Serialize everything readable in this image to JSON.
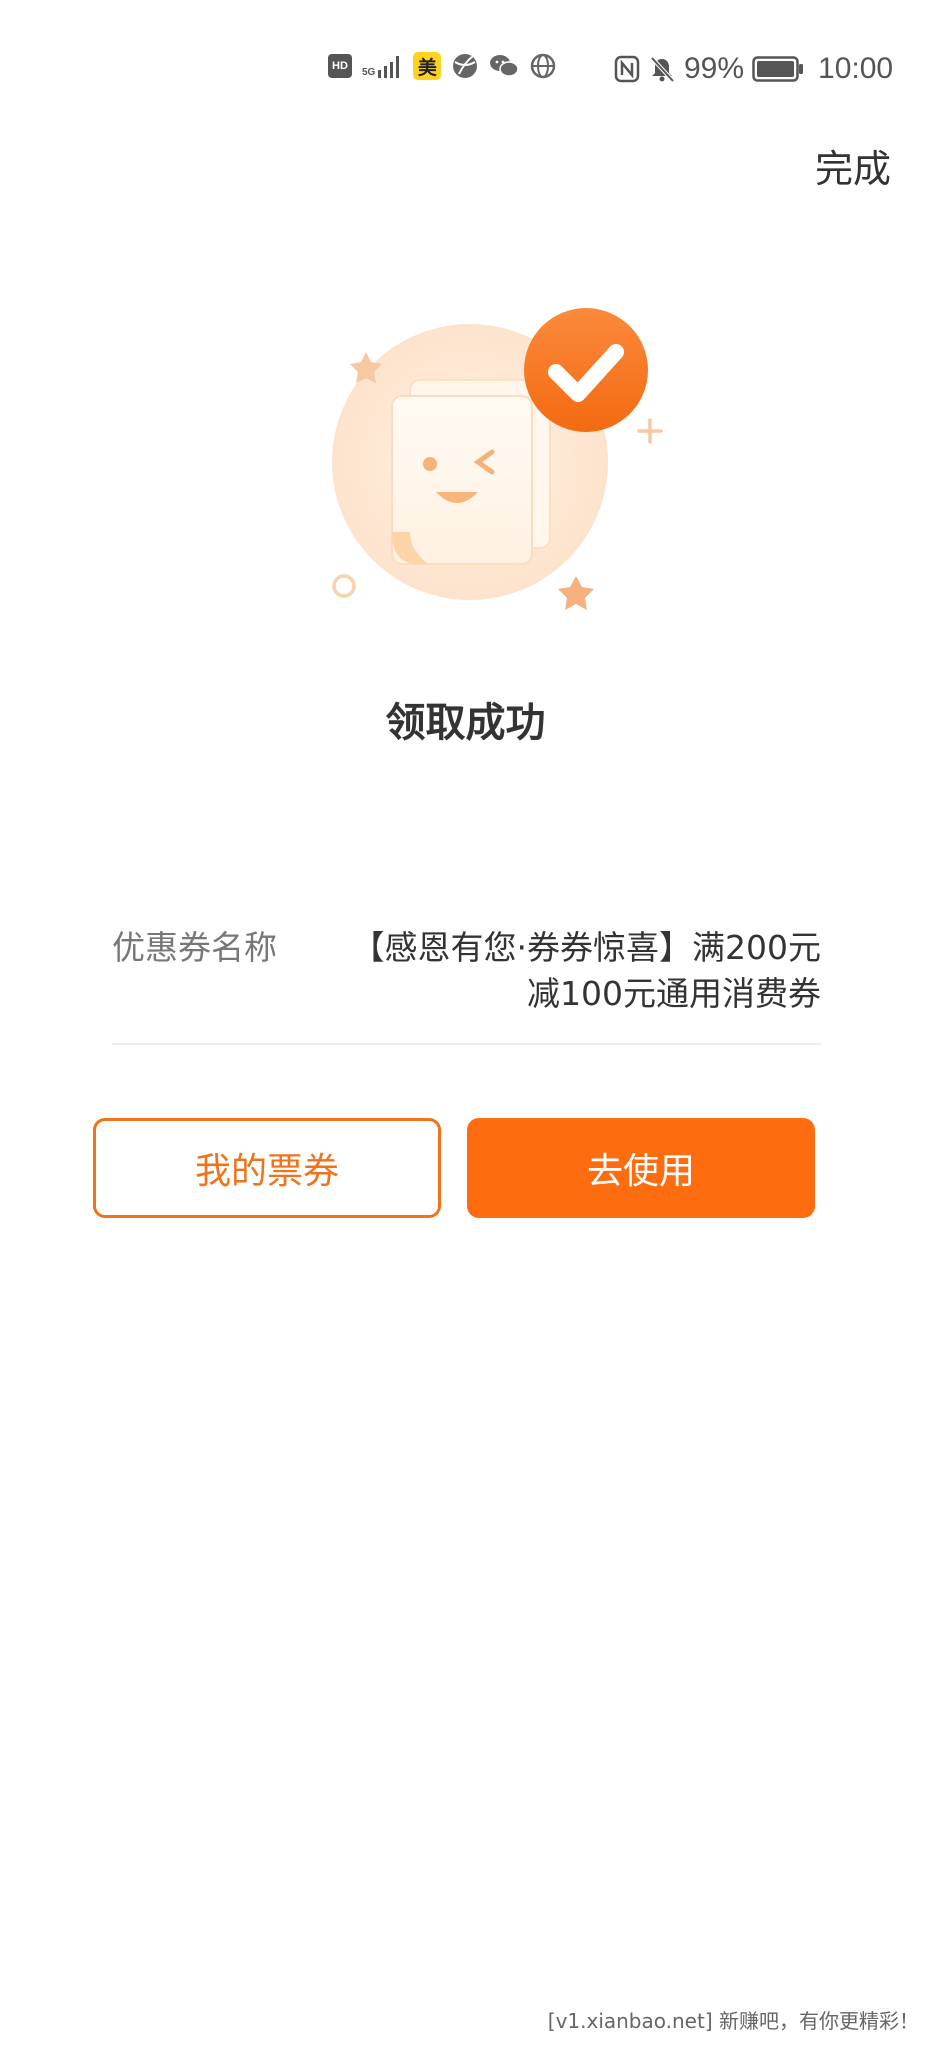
{
  "status_bar": {
    "hd_label": "HD",
    "network_label": "5G",
    "app_badge": "美",
    "battery_percent": "99%",
    "time": "10:00"
  },
  "header": {
    "done_label": "完成"
  },
  "result": {
    "title": "领取成功"
  },
  "coupon": {
    "label": "优惠券名称",
    "name": "【感恩有您·券券惊喜】满200元减100元通用消费券"
  },
  "actions": {
    "my_tickets_label": "我的票券",
    "use_label": "去使用"
  },
  "footer": {
    "watermark": "[v1.xianbao.net] 新赚吧，有你更精彩！"
  },
  "colors": {
    "accent": "#fd6d10",
    "accent_outline": "#f07319"
  }
}
